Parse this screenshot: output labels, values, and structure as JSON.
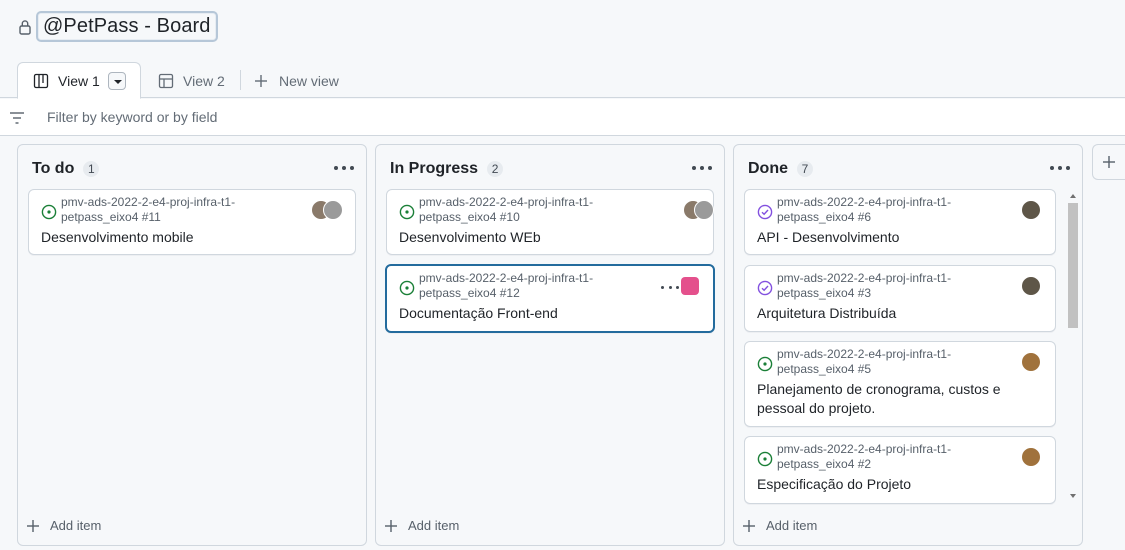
{
  "project": {
    "title": "@PetPass - Board"
  },
  "views": {
    "tabs": [
      {
        "label": "View 1",
        "active": true
      },
      {
        "label": "View 2",
        "active": false
      }
    ],
    "new_view_label": "New view"
  },
  "filter": {
    "placeholder": "Filter by keyword or by field"
  },
  "columns": [
    {
      "title": "To do",
      "count": "1",
      "add_item_label": "Add item",
      "cards": [
        {
          "ref_line1": "pmv-ads-2022-2-e4-proj-infra-t1-",
          "ref_line2": "petpass_eixo4 #11",
          "title": "Desenvolvimento mobile",
          "status": "open"
        }
      ]
    },
    {
      "title": "In Progress",
      "count": "2",
      "add_item_label": "Add item",
      "cards": [
        {
          "ref_line1": "pmv-ads-2022-2-e4-proj-infra-t1-",
          "ref_line2": "petpass_eixo4 #10",
          "title": "Desenvolvimento WEb",
          "status": "open"
        },
        {
          "ref_line1": "pmv-ads-2022-2-e4-proj-infra-t1-",
          "ref_line2": "petpass_eixo4 #12",
          "title": "Documentação Front-end",
          "status": "open"
        }
      ]
    },
    {
      "title": "Done",
      "count": "7",
      "add_item_label": "Add item",
      "cards": [
        {
          "ref_line1": "pmv-ads-2022-2-e4-proj-infra-t1-",
          "ref_line2": "petpass_eixo4 #6",
          "title": "API - Desenvolvimento",
          "status": "closed"
        },
        {
          "ref_line1": "pmv-ads-2022-2-e4-proj-infra-t1-",
          "ref_line2": "petpass_eixo4 #3",
          "title": "Arquitetura Distribuída",
          "status": "closed"
        },
        {
          "ref_line1": "pmv-ads-2022-2-e4-proj-infra-t1-",
          "ref_line2": "petpass_eixo4 #5",
          "title": "Planejamento de cronograma, custos e pessoal do projeto.",
          "status": "open"
        },
        {
          "ref_line1": "pmv-ads-2022-2-e4-proj-infra-t1-",
          "ref_line2": "petpass_eixo4 #2",
          "title": "Especificação do Projeto",
          "status": "open"
        }
      ]
    }
  ],
  "colors": {
    "open_status": "#1a7f37",
    "closed_status": "#8250df",
    "focus_border": "#236b9d"
  }
}
